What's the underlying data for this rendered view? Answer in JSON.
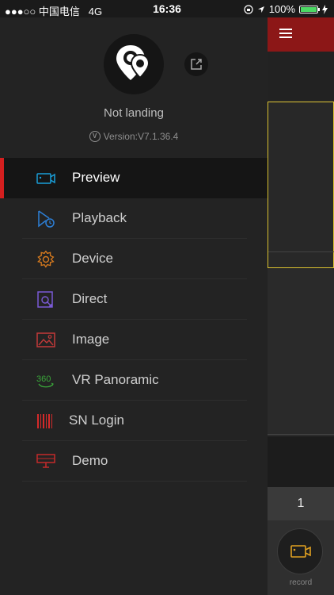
{
  "status_bar": {
    "signal": "●●●○○",
    "carrier": "中国电信",
    "network": "4G",
    "time": "16:36",
    "battery_pct": "100%",
    "battery_level": 1.0,
    "icons": [
      "lock-rotation-icon",
      "location-arrow-icon",
      "battery-icon",
      "charging-icon"
    ]
  },
  "profile": {
    "username": "Not landing",
    "version": "Version:V7.1.36.4",
    "version_logo": "V",
    "avatar_icon": "location-pin-icon",
    "share_icon": "share-icon"
  },
  "menu": {
    "items": [
      {
        "label": "Preview",
        "icon": "camera-icon",
        "color": "#1a9ed8",
        "active": true
      },
      {
        "label": "Playback",
        "icon": "playback-clock-icon",
        "color": "#2d7fd6"
      },
      {
        "label": "Device",
        "icon": "gear-icon",
        "color": "#d67a1e"
      },
      {
        "label": "Direct",
        "icon": "direct-connect-icon",
        "color": "#7b5bd6"
      },
      {
        "label": "Image",
        "icon": "image-icon",
        "color": "#c43a3a"
      },
      {
        "label": "VR Panoramic",
        "icon": "vr-360-icon",
        "color": "#3aa63a"
      },
      {
        "label": "SN Login",
        "icon": "barcode-icon",
        "color": "#d42a2a"
      },
      {
        "label": "Demo",
        "icon": "demo-screen-icon",
        "color": "#c42a2a"
      }
    ]
  },
  "main": {
    "menu_icon": "hamburger-icon",
    "page_number": "1",
    "record_label": "record",
    "record_icon": "record-camera-icon",
    "accent": "#8c1717",
    "selection_border": "#d8c030"
  }
}
